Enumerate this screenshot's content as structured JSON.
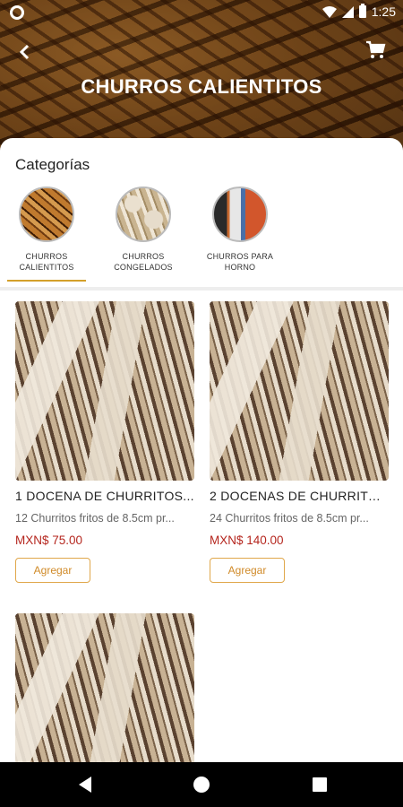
{
  "status": {
    "time": "1:25"
  },
  "header": {
    "title": "CHURROS CALIENTITOS"
  },
  "categories": {
    "title": "Categorías",
    "items": [
      {
        "label": "CHURROS CALIENTITOS",
        "selected": true
      },
      {
        "label": "CHURROS CONGELADOS",
        "selected": false
      },
      {
        "label": "CHURROS PARA HORNO",
        "selected": false
      }
    ]
  },
  "products": [
    {
      "name": "1 DOCENA DE CHURRITOS...",
      "desc": "12 Churritos fritos de 8.5cm pr...",
      "price": "MXN$ 75.00",
      "button": "Agregar"
    },
    {
      "name": "2 DOCENAS DE CHURRITO...",
      "desc": "24 Churritos fritos de 8.5cm pr...",
      "price": "MXN$ 140.00",
      "button": "Agregar"
    },
    {
      "name": "",
      "desc": "",
      "price": "",
      "button": ""
    }
  ],
  "colors": {
    "accent": "#d4a02a",
    "price": "#b5261e",
    "button_border": "#e0a74a"
  },
  "icons": [
    "back-arrow-icon",
    "cart-icon",
    "wifi-icon",
    "signal-icon",
    "battery-icon",
    "nav-back-icon",
    "nav-home-icon",
    "nav-recent-icon"
  ]
}
